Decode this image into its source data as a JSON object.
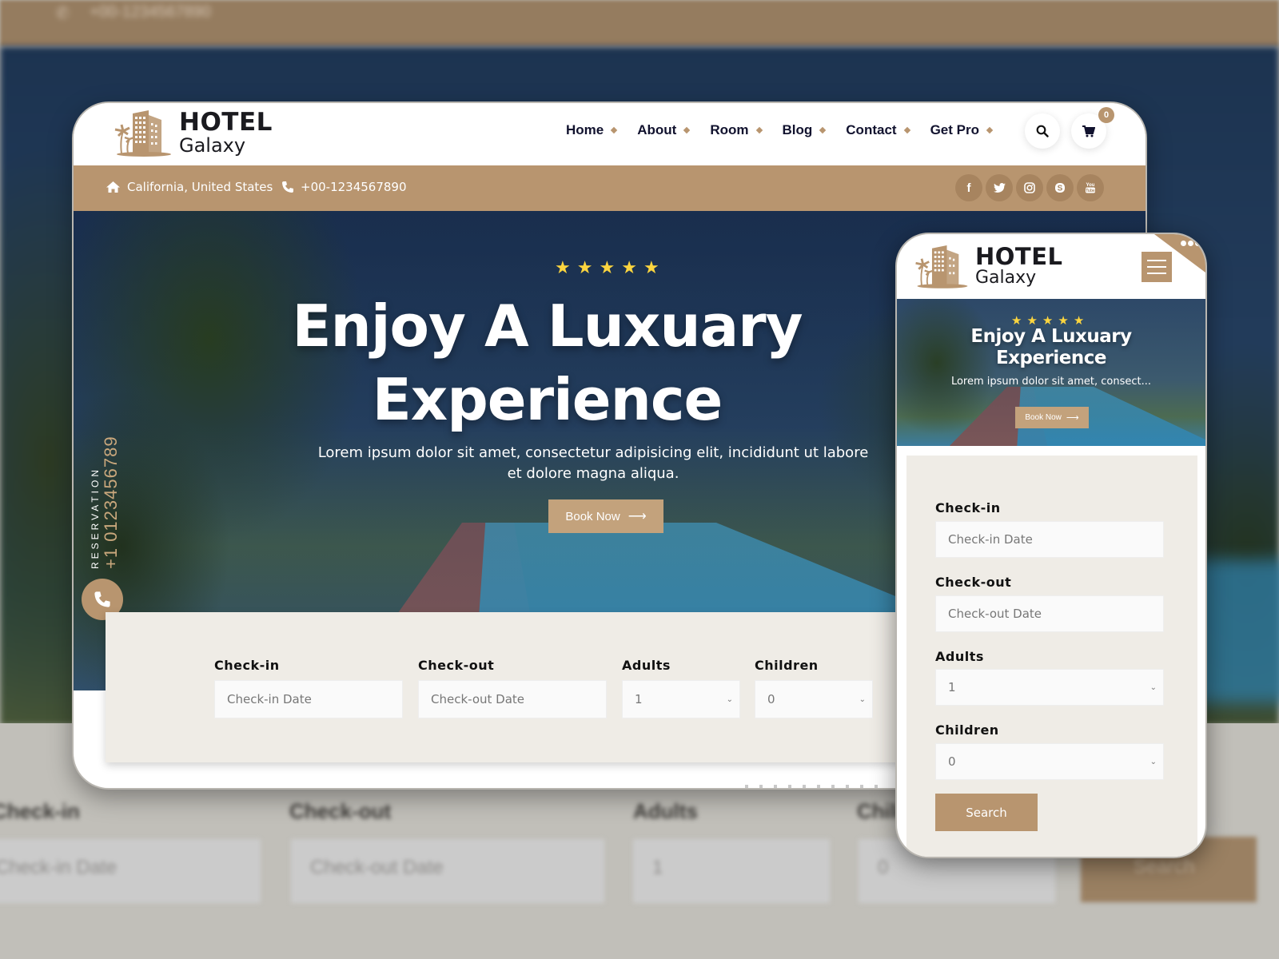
{
  "background": {
    "topbar_phone": "+00-1234567890",
    "form_labels": [
      "Check-in",
      "Check-out",
      "Adults",
      "Children"
    ],
    "form_fields": [
      "Check-in Date",
      "Check-out Date",
      "1",
      "0"
    ],
    "search_label": "Search"
  },
  "brand": {
    "name_line1": "HOTEL",
    "name_line2": "Galaxy",
    "accent_color": "#b8956f",
    "star_color": "#fcd53f"
  },
  "nav": {
    "items": [
      {
        "label": "Home"
      },
      {
        "label": "About"
      },
      {
        "label": "Room"
      },
      {
        "label": "Blog"
      },
      {
        "label": "Contact"
      },
      {
        "label": "Get Pro"
      }
    ],
    "search_icon": "search-icon",
    "cart_icon": "cart-icon",
    "cart_count": "0"
  },
  "topbar": {
    "address": "California, United States",
    "phone": "+00-1234567890",
    "socials": [
      "facebook",
      "twitter",
      "instagram",
      "skype",
      "youtube"
    ]
  },
  "hero": {
    "rating": 5,
    "stars": "★★★★★",
    "title_line1": "Enjoy A Luxuary",
    "title_line2": "Experience",
    "subtitle": "Lorem ipsum dolor sit amet, consectetur adipisicing elit, incididunt ut labore et dolore magna aliqua.",
    "book_label": "Book Now",
    "reservation_label": "RESERVATION",
    "reservation_phone": "+1 0123456789"
  },
  "booking": {
    "checkin_label": "Check-in",
    "checkin_placeholder": "Check-in Date",
    "checkout_label": "Check-out",
    "checkout_placeholder": "Check-out Date",
    "adults_label": "Adults",
    "adults_value": "1",
    "children_label": "Children",
    "children_value": "0",
    "search_label": "Search"
  },
  "mobile": {
    "title_line1": "Enjoy A Luxuary",
    "title_line2": "Experience",
    "subtitle": "Lorem ipsum dolor sit amet, consect...",
    "book_label": "Book Now"
  }
}
